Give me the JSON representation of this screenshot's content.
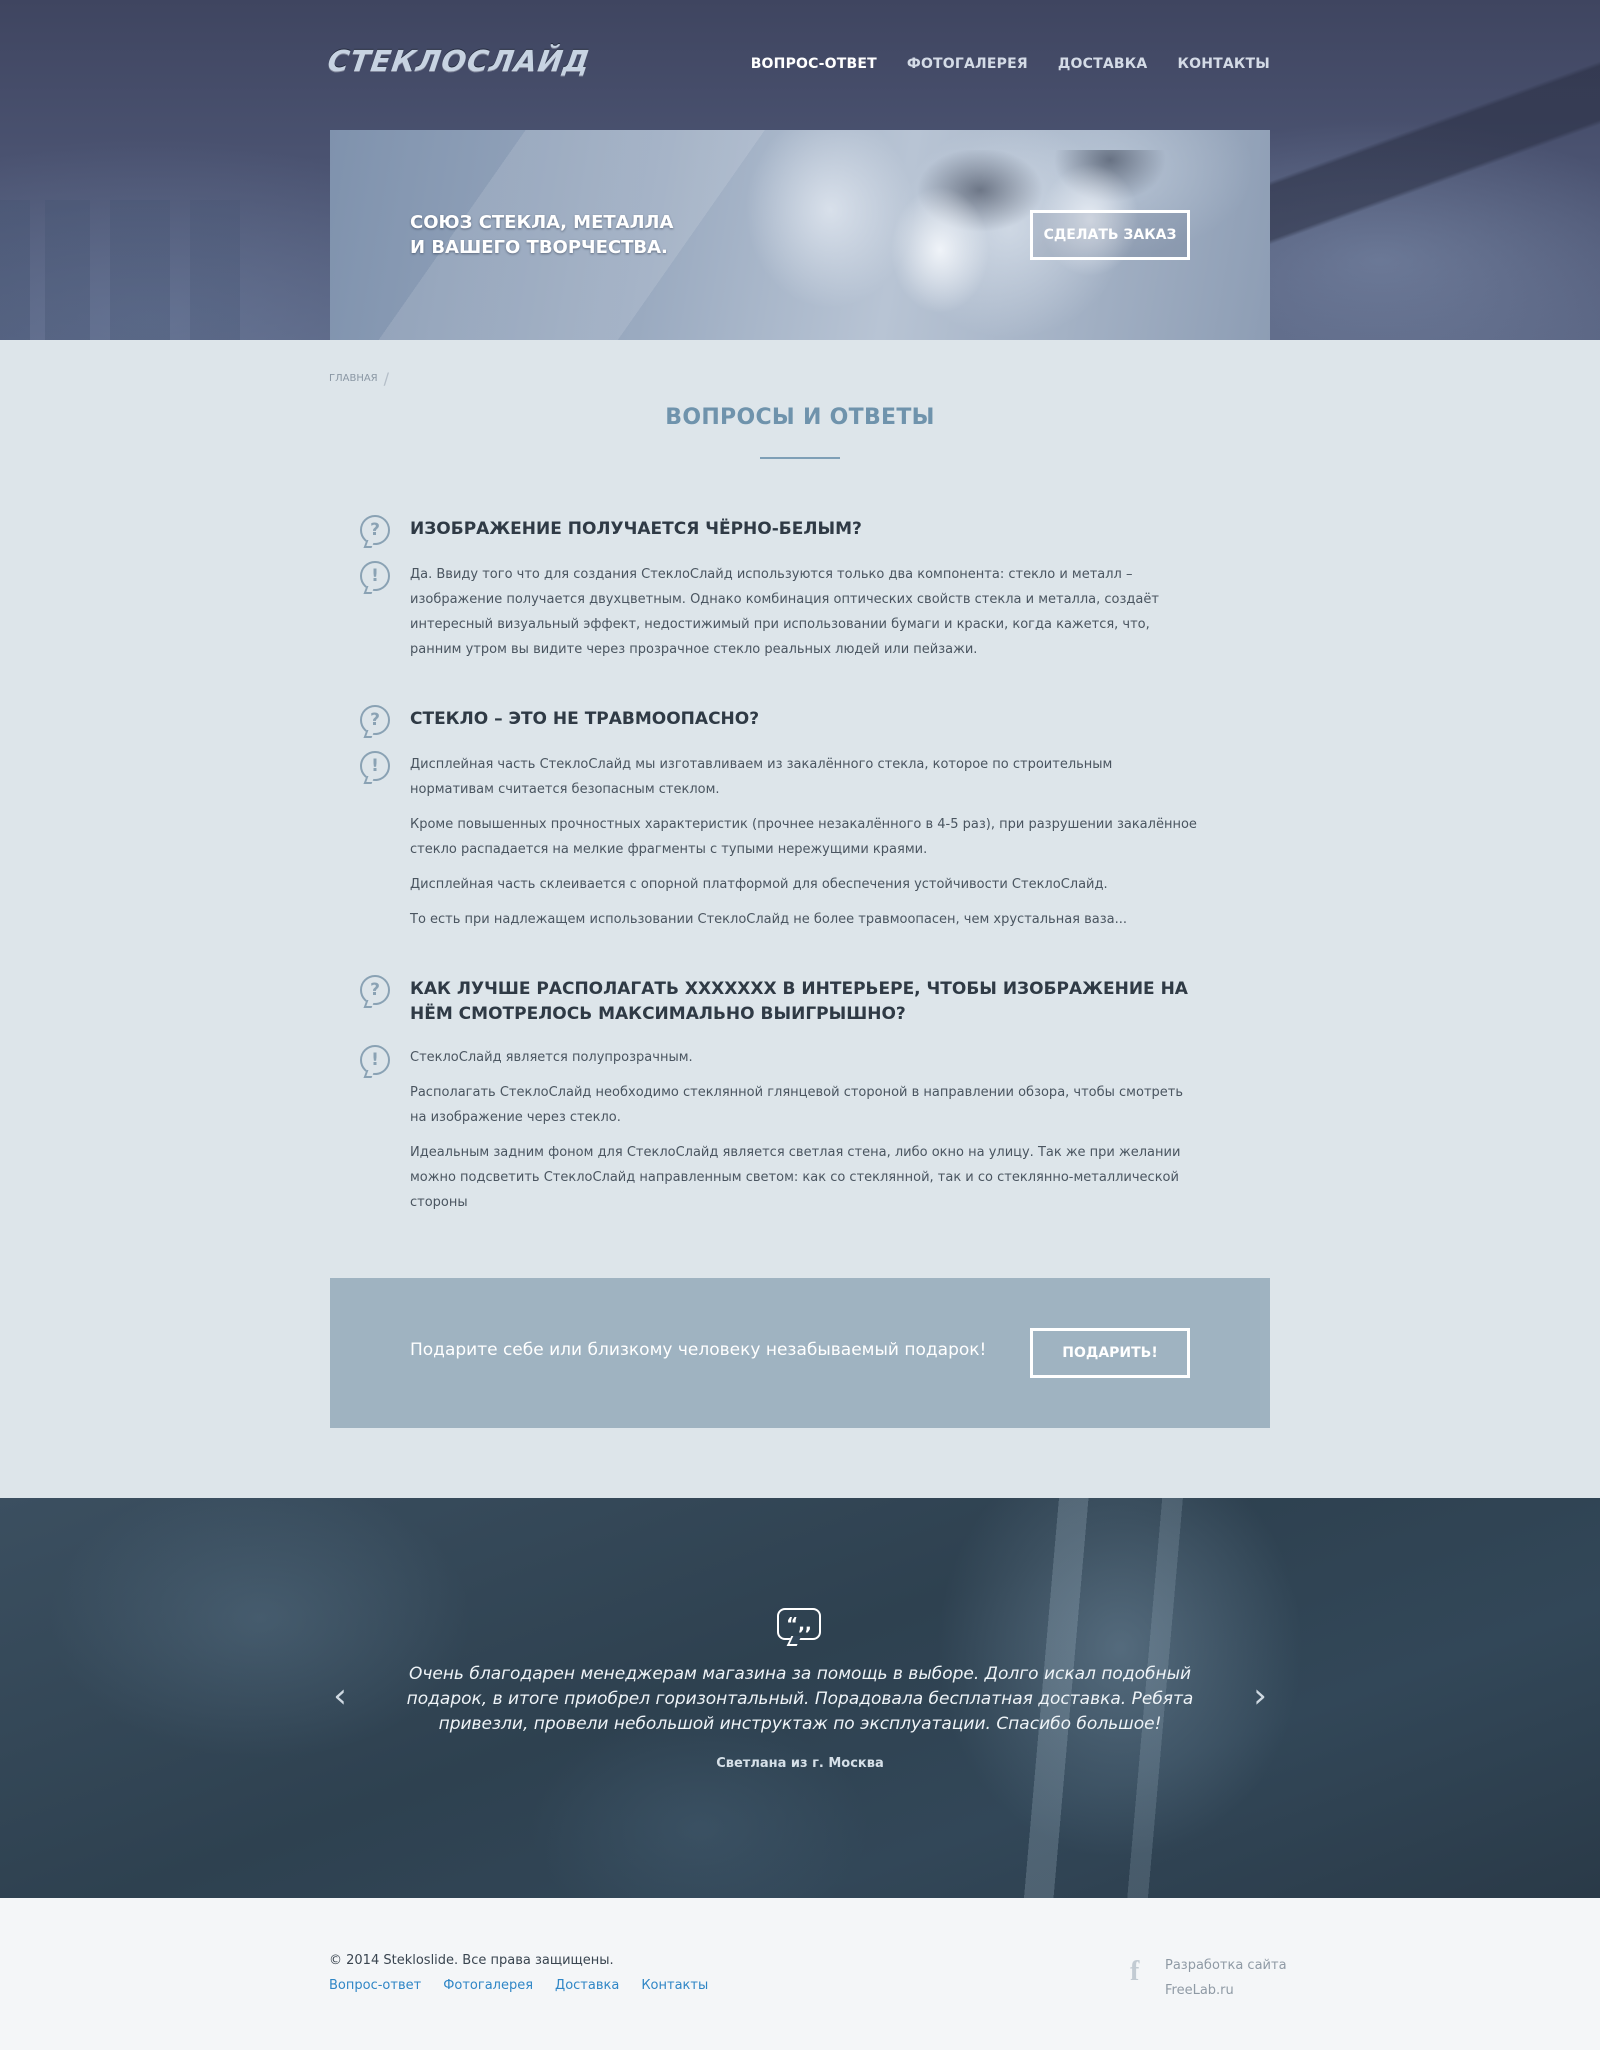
{
  "header": {
    "logo": "СТЕКЛОСЛАЙД",
    "nav": [
      {
        "label": "ВОПРОС-ОТВЕТ"
      },
      {
        "label": "ФОТОГАЛЕРЕЯ"
      },
      {
        "label": "ДОСТАВКА"
      },
      {
        "label": "КОНТАКТЫ"
      }
    ],
    "banner": {
      "line1": "СОЮЗ СТЕКЛА, МЕТАЛЛА",
      "line2": "И ВАШЕГО ТВОРЧЕСТВА.",
      "button": "СДЕЛАТЬ ЗАКАЗ"
    }
  },
  "breadcrumb": {
    "item": "ГЛАВНАЯ",
    "separator": "/"
  },
  "page_title": "ВОПРОСЫ И ОТВЕТЫ",
  "icons": {
    "question": "?",
    "answer": "!"
  },
  "faq": [
    {
      "question": "ИЗОБРАЖЕНИЕ ПОЛУЧАЕТСЯ ЧЁРНО-БЕЛЫМ?",
      "answer": [
        "Да. Ввиду того что для создания СтеклоСлайд используются только два компонента: стекло и металл – изображение получается двухцветным. Однако комбинация оптических свойств стекла и металла, создаёт интересный визуальный эффект, недостижимый при использовании бумаги и краски, когда кажется, что, ранним утром вы видите через прозрачное стекло реальных людей или пейзажи."
      ]
    },
    {
      "question": "СТЕКЛО – ЭТО НЕ ТРАВМООПАСНО?",
      "answer": [
        "Дисплейная часть СтеклоСлайд мы изготавливаем из закалённого стекла, которое по строительным нормативам считается безопасным стеклом.",
        "Кроме повышенных прочностных характеристик (прочнее незакалённого в 4-5 раз), при разрушении закалённое стекло распадается на мелкие фрагменты с тупыми нережущими краями.",
        "Дисплейная часть склеивается с опорной платформой для обеспечения устойчивости СтеклоСлайд.",
        "То есть при надлежащем использовании СтеклоСлайд не более травмоопасен, чем хрустальная ваза..."
      ]
    },
    {
      "question": "КАК ЛУЧШЕ РАСПОЛАГАТЬ XXXXXXX В ИНТЕРЬЕРЕ, ЧТОБЫ ИЗОБРАЖЕНИЕ НА НЁМ СМОТРЕЛОСЬ МАКСИМАЛЬНО ВЫИГРЫШНО?",
      "answer": [
        "СтеклоСлайд является полупрозрачным.",
        "Располагать СтеклоСлайд необходимо стеклянной глянцевой стороной в направлении обзора, чтобы смотреть на изображение через стекло.",
        "Идеальным задним фоном для СтеклоСлайд является светлая стена, либо окно на улицу. Так же при желании можно подсветить СтеклоСлайд направленным светом: как со стеклянной, так и со стеклянно-металлической стороны"
      ]
    }
  ],
  "gift": {
    "text": "Подарите себе или близкому человеку незабываемый подарок!",
    "button": "ПОДАРИТЬ!"
  },
  "testimonial": {
    "quote_icon": "“,,",
    "text": "Очень благодарен менеджерам магазина за помощь в выборе. Долго искал подобный подарок, в итоге приобрел горизонтальный. Порадовала бесплатная доставка. Ребята привезли, провели небольшой инструктаж по эксплуатации. Спасибо большое!",
    "author": "Светлана из г. Москва",
    "prev_arrow": "‹",
    "next_arrow": "›"
  },
  "footer": {
    "copyright": "© 2014 Stekloslide. Все права защищены.",
    "links": [
      {
        "label": "Вопрос-ответ"
      },
      {
        "label": "Фотогалерея"
      },
      {
        "label": "Доставка"
      },
      {
        "label": "Контакты"
      }
    ],
    "facebook_icon": "f",
    "developer_line1": "Разработка сайта",
    "developer_line2": "FreeLab.ru"
  }
}
